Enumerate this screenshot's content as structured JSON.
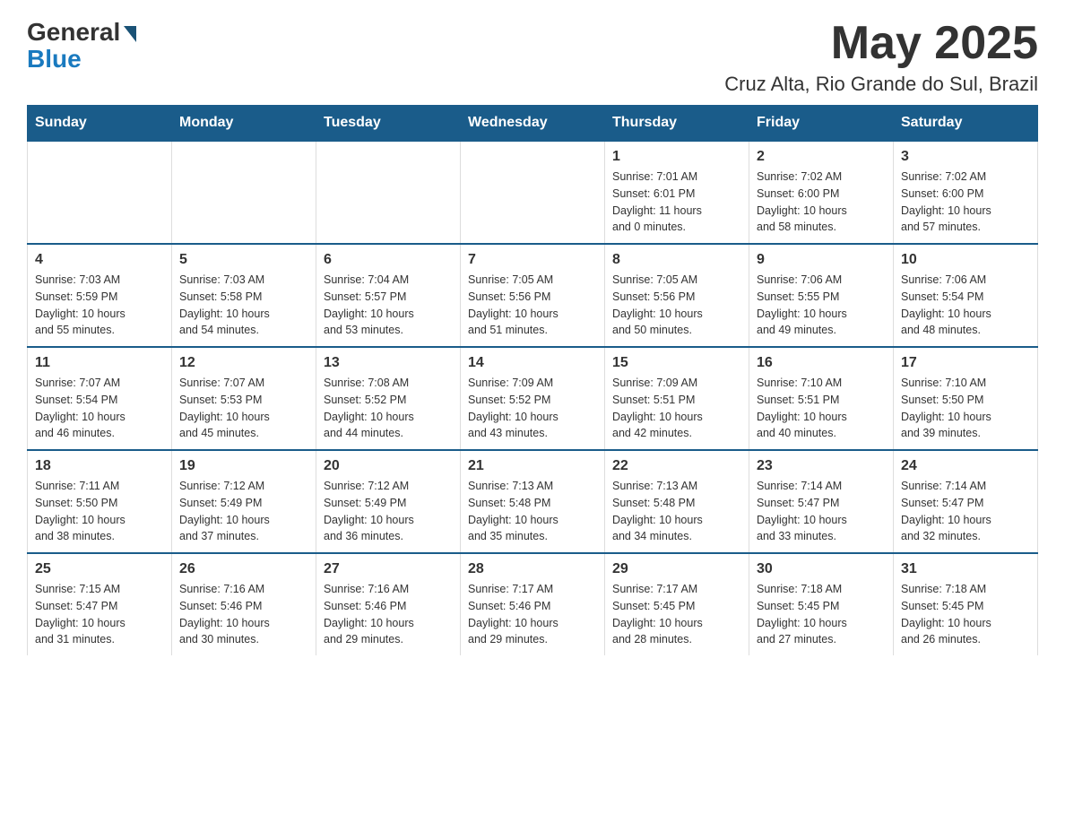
{
  "header": {
    "logo_general": "General",
    "logo_blue": "Blue",
    "month_year": "May 2025",
    "location": "Cruz Alta, Rio Grande do Sul, Brazil"
  },
  "weekdays": [
    "Sunday",
    "Monday",
    "Tuesday",
    "Wednesday",
    "Thursday",
    "Friday",
    "Saturday"
  ],
  "weeks": [
    [
      {
        "day": "",
        "info": ""
      },
      {
        "day": "",
        "info": ""
      },
      {
        "day": "",
        "info": ""
      },
      {
        "day": "",
        "info": ""
      },
      {
        "day": "1",
        "info": "Sunrise: 7:01 AM\nSunset: 6:01 PM\nDaylight: 11 hours\nand 0 minutes."
      },
      {
        "day": "2",
        "info": "Sunrise: 7:02 AM\nSunset: 6:00 PM\nDaylight: 10 hours\nand 58 minutes."
      },
      {
        "day": "3",
        "info": "Sunrise: 7:02 AM\nSunset: 6:00 PM\nDaylight: 10 hours\nand 57 minutes."
      }
    ],
    [
      {
        "day": "4",
        "info": "Sunrise: 7:03 AM\nSunset: 5:59 PM\nDaylight: 10 hours\nand 55 minutes."
      },
      {
        "day": "5",
        "info": "Sunrise: 7:03 AM\nSunset: 5:58 PM\nDaylight: 10 hours\nand 54 minutes."
      },
      {
        "day": "6",
        "info": "Sunrise: 7:04 AM\nSunset: 5:57 PM\nDaylight: 10 hours\nand 53 minutes."
      },
      {
        "day": "7",
        "info": "Sunrise: 7:05 AM\nSunset: 5:56 PM\nDaylight: 10 hours\nand 51 minutes."
      },
      {
        "day": "8",
        "info": "Sunrise: 7:05 AM\nSunset: 5:56 PM\nDaylight: 10 hours\nand 50 minutes."
      },
      {
        "day": "9",
        "info": "Sunrise: 7:06 AM\nSunset: 5:55 PM\nDaylight: 10 hours\nand 49 minutes."
      },
      {
        "day": "10",
        "info": "Sunrise: 7:06 AM\nSunset: 5:54 PM\nDaylight: 10 hours\nand 48 minutes."
      }
    ],
    [
      {
        "day": "11",
        "info": "Sunrise: 7:07 AM\nSunset: 5:54 PM\nDaylight: 10 hours\nand 46 minutes."
      },
      {
        "day": "12",
        "info": "Sunrise: 7:07 AM\nSunset: 5:53 PM\nDaylight: 10 hours\nand 45 minutes."
      },
      {
        "day": "13",
        "info": "Sunrise: 7:08 AM\nSunset: 5:52 PM\nDaylight: 10 hours\nand 44 minutes."
      },
      {
        "day": "14",
        "info": "Sunrise: 7:09 AM\nSunset: 5:52 PM\nDaylight: 10 hours\nand 43 minutes."
      },
      {
        "day": "15",
        "info": "Sunrise: 7:09 AM\nSunset: 5:51 PM\nDaylight: 10 hours\nand 42 minutes."
      },
      {
        "day": "16",
        "info": "Sunrise: 7:10 AM\nSunset: 5:51 PM\nDaylight: 10 hours\nand 40 minutes."
      },
      {
        "day": "17",
        "info": "Sunrise: 7:10 AM\nSunset: 5:50 PM\nDaylight: 10 hours\nand 39 minutes."
      }
    ],
    [
      {
        "day": "18",
        "info": "Sunrise: 7:11 AM\nSunset: 5:50 PM\nDaylight: 10 hours\nand 38 minutes."
      },
      {
        "day": "19",
        "info": "Sunrise: 7:12 AM\nSunset: 5:49 PM\nDaylight: 10 hours\nand 37 minutes."
      },
      {
        "day": "20",
        "info": "Sunrise: 7:12 AM\nSunset: 5:49 PM\nDaylight: 10 hours\nand 36 minutes."
      },
      {
        "day": "21",
        "info": "Sunrise: 7:13 AM\nSunset: 5:48 PM\nDaylight: 10 hours\nand 35 minutes."
      },
      {
        "day": "22",
        "info": "Sunrise: 7:13 AM\nSunset: 5:48 PM\nDaylight: 10 hours\nand 34 minutes."
      },
      {
        "day": "23",
        "info": "Sunrise: 7:14 AM\nSunset: 5:47 PM\nDaylight: 10 hours\nand 33 minutes."
      },
      {
        "day": "24",
        "info": "Sunrise: 7:14 AM\nSunset: 5:47 PM\nDaylight: 10 hours\nand 32 minutes."
      }
    ],
    [
      {
        "day": "25",
        "info": "Sunrise: 7:15 AM\nSunset: 5:47 PM\nDaylight: 10 hours\nand 31 minutes."
      },
      {
        "day": "26",
        "info": "Sunrise: 7:16 AM\nSunset: 5:46 PM\nDaylight: 10 hours\nand 30 minutes."
      },
      {
        "day": "27",
        "info": "Sunrise: 7:16 AM\nSunset: 5:46 PM\nDaylight: 10 hours\nand 29 minutes."
      },
      {
        "day": "28",
        "info": "Sunrise: 7:17 AM\nSunset: 5:46 PM\nDaylight: 10 hours\nand 29 minutes."
      },
      {
        "day": "29",
        "info": "Sunrise: 7:17 AM\nSunset: 5:45 PM\nDaylight: 10 hours\nand 28 minutes."
      },
      {
        "day": "30",
        "info": "Sunrise: 7:18 AM\nSunset: 5:45 PM\nDaylight: 10 hours\nand 27 minutes."
      },
      {
        "day": "31",
        "info": "Sunrise: 7:18 AM\nSunset: 5:45 PM\nDaylight: 10 hours\nand 26 minutes."
      }
    ]
  ]
}
